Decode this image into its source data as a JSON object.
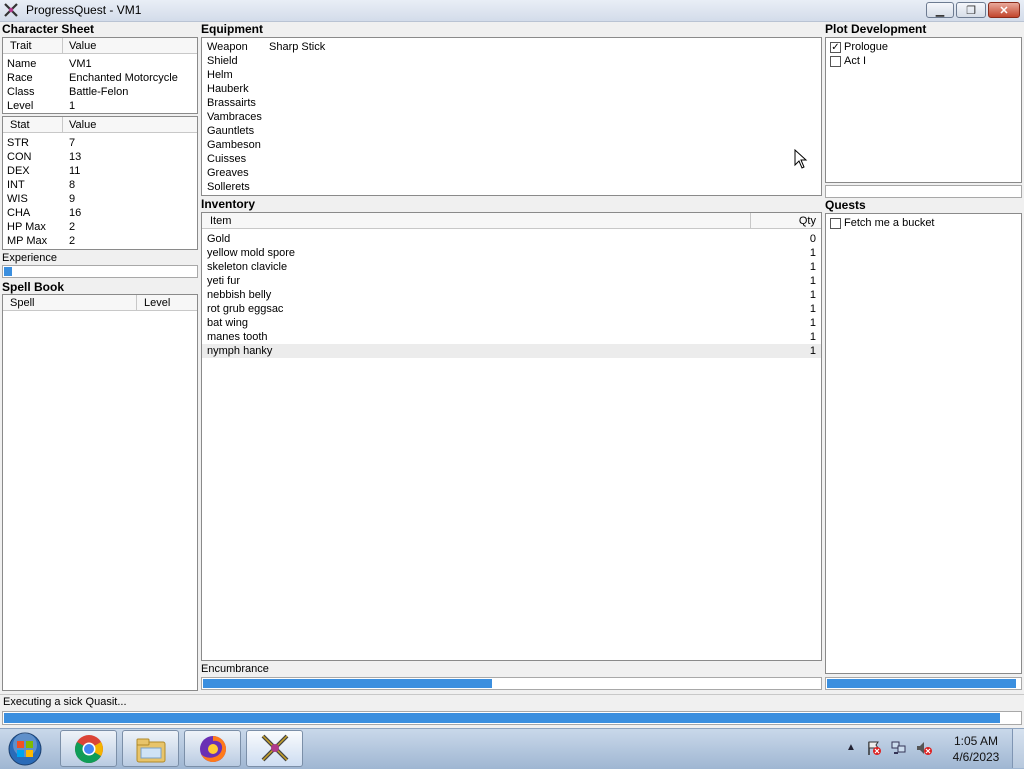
{
  "window": {
    "title": "ProgressQuest - VM1",
    "controls": {
      "minimize": "▁",
      "maximize": "❐",
      "close": "✕"
    }
  },
  "character_sheet": {
    "title": "Character Sheet",
    "traits_header": {
      "col1": "Trait",
      "col2": "Value"
    },
    "traits": [
      {
        "name": "Name",
        "value": "VM1"
      },
      {
        "name": "Race",
        "value": "Enchanted Motorcycle"
      },
      {
        "name": "Class",
        "value": "Battle-Felon"
      },
      {
        "name": "Level",
        "value": "1"
      }
    ],
    "stats_header": {
      "col1": "Stat",
      "col2": "Value"
    },
    "stats": [
      {
        "name": "STR",
        "value": "7"
      },
      {
        "name": "CON",
        "value": "13"
      },
      {
        "name": "DEX",
        "value": "11"
      },
      {
        "name": "INT",
        "value": "8"
      },
      {
        "name": "WIS",
        "value": "9"
      },
      {
        "name": "CHA",
        "value": "16"
      },
      {
        "name": "HP Max",
        "value": "2"
      },
      {
        "name": "MP Max",
        "value": "2"
      }
    ],
    "experience_label": "Experience",
    "experience_progress": 0.05
  },
  "spell_book": {
    "title": "Spell Book",
    "header": {
      "col1": "Spell",
      "col2": "Level"
    }
  },
  "equipment": {
    "title": "Equipment",
    "items": [
      {
        "slot": "Weapon",
        "value": "Sharp Stick"
      },
      {
        "slot": "Shield",
        "value": ""
      },
      {
        "slot": "Helm",
        "value": ""
      },
      {
        "slot": "Hauberk",
        "value": ""
      },
      {
        "slot": "Brassairts",
        "value": ""
      },
      {
        "slot": "Vambraces",
        "value": ""
      },
      {
        "slot": "Gauntlets",
        "value": ""
      },
      {
        "slot": "Gambeson",
        "value": ""
      },
      {
        "slot": "Cuisses",
        "value": ""
      },
      {
        "slot": "Greaves",
        "value": ""
      },
      {
        "slot": "Sollerets",
        "value": ""
      }
    ]
  },
  "inventory": {
    "title": "Inventory",
    "header": {
      "col1": "Item",
      "col2": "Qty"
    },
    "items": [
      {
        "item": "Gold",
        "qty": "0"
      },
      {
        "item": "yellow mold spore",
        "qty": "1"
      },
      {
        "item": "skeleton clavicle",
        "qty": "1"
      },
      {
        "item": "yeti fur",
        "qty": "1"
      },
      {
        "item": "nebbish belly",
        "qty": "1"
      },
      {
        "item": "rot grub eggsac",
        "qty": "1"
      },
      {
        "item": "bat wing",
        "qty": "1"
      },
      {
        "item": "manes tooth",
        "qty": "1"
      },
      {
        "item": "nymph hanky",
        "qty": "1"
      }
    ],
    "encumbrance_label": "Encumbrance",
    "encumbrance_progress": 0.47
  },
  "plot_development": {
    "title": "Plot Development",
    "acts": [
      {
        "label": "Prologue",
        "checked": true
      },
      {
        "label": "Act I",
        "checked": false
      }
    ],
    "progress": 0.0
  },
  "quests": {
    "title": "Quests",
    "items": [
      {
        "label": "Fetch me a bucket",
        "checked": false
      }
    ],
    "progress": 0.98
  },
  "status": {
    "text": "Executing a sick Quasit...",
    "progress": 0.98
  },
  "taskbar": {
    "pinned": [
      "start-orb",
      "chrome",
      "file-explorer",
      "firefox",
      "progressquest"
    ],
    "tray_icons": [
      "show-hidden-icons",
      "action-center-flag",
      "network",
      "volume-muted"
    ],
    "clock_time": "1:05 AM",
    "clock_date": "4/6/2023"
  },
  "colors": {
    "accent": "#3b8fdf",
    "taskbar": "#b5c9e2"
  }
}
